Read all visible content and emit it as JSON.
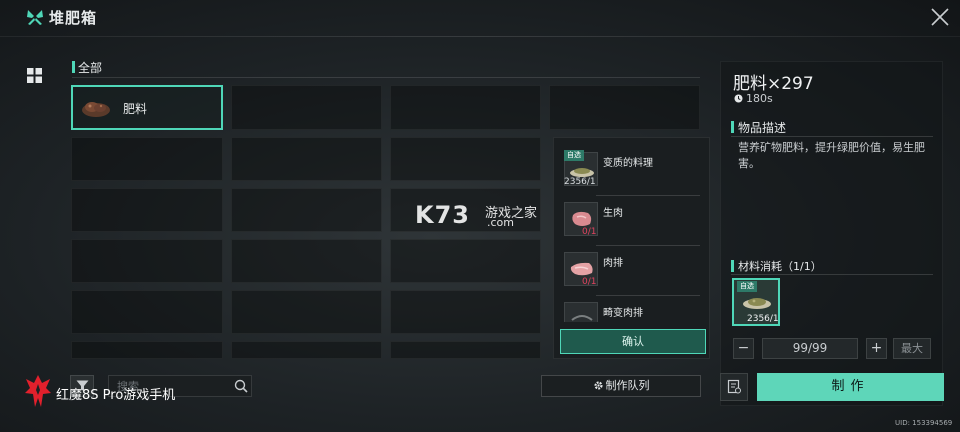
{
  "header": {
    "title": "堆肥箱",
    "logo_icon": "crossed-blades-icon",
    "close_icon": "close-icon"
  },
  "sidebar": {
    "grid_icon": "grid-view-icon"
  },
  "category": {
    "label": "全部"
  },
  "grid": {
    "selected_item": {
      "name": "肥料",
      "icon": "fertilizer-pile-icon"
    }
  },
  "recipe_popup": {
    "items": [
      {
        "name": "变质的料理",
        "count": "2356/1",
        "tag": "自选",
        "icon": "spoiled-dish-icon",
        "enough": true
      },
      {
        "name": "生肉",
        "count": "0/1",
        "icon": "raw-meat-icon",
        "enough": false
      },
      {
        "name": "肉排",
        "count": "0/1",
        "icon": "steak-icon",
        "enough": false
      },
      {
        "name": "畸变肉排",
        "count": "",
        "icon": "mutant-steak-icon",
        "enough": false
      }
    ],
    "confirm_label": "确认"
  },
  "detail": {
    "title": "肥料×297",
    "time": "180s",
    "time_icon": "clock-icon",
    "desc_heading": "物品描述",
    "desc_text": "营养矿物肥料，提升绿肥价值，易生肥害。",
    "materials_heading": "材料消耗（1/1）",
    "material": {
      "tag": "自选",
      "count": "2356/1",
      "icon": "spoiled-dish-icon"
    },
    "qty": {
      "minus": "−",
      "value": "99/99",
      "plus": "+",
      "max_label": "最大"
    },
    "craft_label": "制作",
    "recipe_book_icon": "recipe-book-icon",
    "uid": "UID: 153394569"
  },
  "bottom": {
    "filter_icon": "filter-icon",
    "search_placeholder": "搜索",
    "search_icon": "search-icon",
    "queue_label": "制作队列",
    "queue_icon": "gear-icon"
  },
  "brand": {
    "text": "红魔8S Pro游戏手机",
    "logo_icon": "red-magic-logo-icon"
  },
  "watermark": {
    "big": "K73",
    "cn": "游戏之家",
    "domain": ".com"
  },
  "colors": {
    "accent": "#4fd7b8",
    "craft_button": "#5ed6b9",
    "shortage": "#e0435e"
  }
}
